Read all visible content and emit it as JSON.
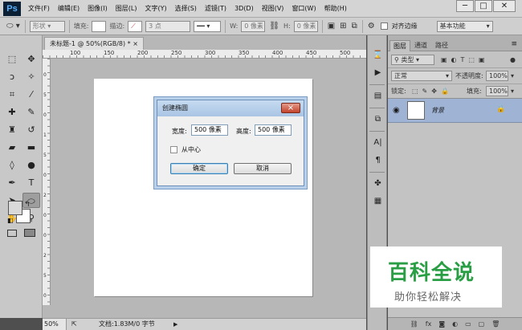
{
  "app": {
    "logo": "Ps"
  },
  "menu": [
    "文件(F)",
    "编辑(E)",
    "图像(I)",
    "图层(L)",
    "文字(Y)",
    "选择(S)",
    "滤镜(T)",
    "3D(D)",
    "视图(V)",
    "窗口(W)",
    "帮助(H)"
  ],
  "window_controls": {
    "minimize": "─",
    "maximize": "□",
    "close": "✕"
  },
  "options": {
    "shape_mode": "形状",
    "fill_label": "填充:",
    "stroke_label": "描边:",
    "stroke_width": "3 点",
    "w_label": "W:",
    "w_value": "0 像素",
    "h_label": "H:",
    "h_value": "0 像素",
    "align_edges": "对齐边缘",
    "workspace": "基本功能"
  },
  "document": {
    "tab_label": "未标题-1 @ 50%(RGB/8) *",
    "ruler_h_ticks": [
      "100",
      "150",
      "200",
      "250",
      "300",
      "350",
      "400",
      "450",
      "500",
      "550",
      "600",
      "650"
    ],
    "ruler_v_ticks": [
      "0",
      "5",
      "0",
      "1",
      "5",
      "0",
      "2",
      "0",
      "0",
      "2",
      "5",
      "0"
    ]
  },
  "status": {
    "zoom": "50%",
    "doc_info": "文档:1.83M/0 字节"
  },
  "dialog": {
    "title": "创建椭圆",
    "width_label": "宽度:",
    "width_value": "500 像素",
    "height_label": "高度:",
    "height_value": "500 像素",
    "from_center_label": "从中心",
    "ok_label": "确定",
    "cancel_label": "取消"
  },
  "layers_panel": {
    "tabs": [
      "图层",
      "通道",
      "路径"
    ],
    "filter_kind": "类型",
    "blend_mode": "正常",
    "opacity_label": "不透明度:",
    "opacity_value": "100%",
    "lock_label": "锁定:",
    "fill_label": "填充:",
    "fill_value": "100%",
    "layer_name": "背景"
  },
  "watermark": {
    "title": "百科全说",
    "subtitle": "助你轻松解决"
  }
}
